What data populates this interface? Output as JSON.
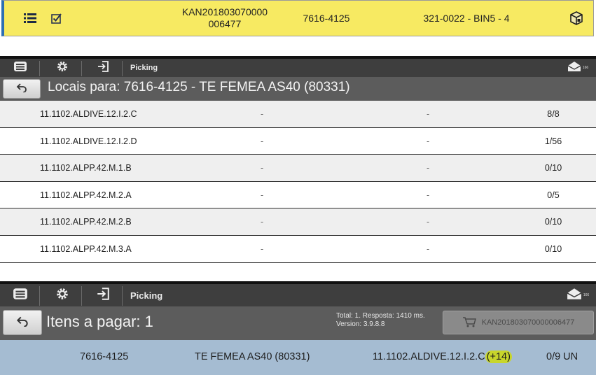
{
  "task_row": {
    "kanban_line1": "KAN201803070000",
    "kanban_line2": "006477",
    "part_code": "7616-4125",
    "bin_location": "321-0022 - BIN5 - 4",
    "icons": [
      "list-icon",
      "checkbox-icon",
      "box-icon"
    ],
    "colors": {
      "background": "#f7ea62",
      "accent": "#2d6fb3"
    }
  },
  "locations_screen": {
    "toolbar": {
      "title": "Picking",
      "badge": "166",
      "icons": [
        "menu-icon",
        "gear-icon",
        "login-icon",
        "mail-icon"
      ]
    },
    "header_title": "Locais para: 7616-4125 - TE FEMEA AS40 (80331)",
    "rows": [
      {
        "location": "11.1102.ALDIVE.12.I.2.C",
        "col2": "-",
        "col3": "-",
        "qty": "8/8"
      },
      {
        "location": "11.1102.ALDIVE.12.I.2.D",
        "col2": "-",
        "col3": "-",
        "qty": "1/56"
      },
      {
        "location": "11.1102.ALPP.42.M.1.B",
        "col2": "-",
        "col3": "-",
        "qty": "0/10"
      },
      {
        "location": "11.1102.ALPP.42.M.2.A",
        "col2": "-",
        "col3": "-",
        "qty": "0/5"
      },
      {
        "location": "11.1102.ALPP.42.M.2.B",
        "col2": "-",
        "col3": "-",
        "qty": "0/10"
      },
      {
        "location": "11.1102.ALPP.42.M.3.A",
        "col2": "-",
        "col3": "-",
        "qty": "0/10"
      }
    ]
  },
  "items_screen": {
    "toolbar": {
      "title": "Picking",
      "badge": "166"
    },
    "header_title": "Itens a pagar: 1",
    "info_line1": "Total: 1. Resposta: 1410 ms.",
    "info_line2": "Version: 3.9.8.8",
    "cart_button": "KAN201803070000006477",
    "item": {
      "part": "7616-4125",
      "description": "TE FEMEA AS40 (80331)",
      "location": "11.1102.ALDIVE.12.I.2.C",
      "extra": "(+14)",
      "quantity": "0/9 UN"
    },
    "colors": {
      "item_row": "#a5bcd2",
      "highlight": "#c8d62b"
    }
  }
}
